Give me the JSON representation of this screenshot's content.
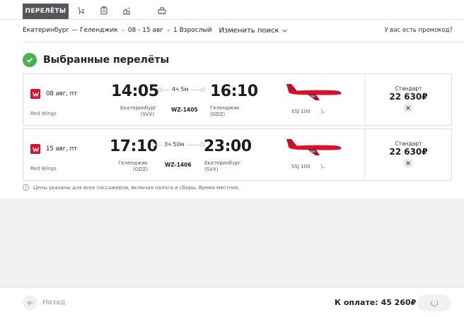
{
  "tabs": {
    "active_label": "ПЕРЕЛЁТЫ",
    "icons": [
      "seat-icon",
      "luggage-icon",
      "hotel-icon",
      "car-icon"
    ]
  },
  "search": {
    "route": "Екатеринбург — Геленджик",
    "dates": "08 - 15 авг",
    "passengers": "1 Взрослый",
    "change_label": "Изменить поиск",
    "promo_label": "У вас есть промокод?"
  },
  "selected": {
    "title": "Выбранные перелёты"
  },
  "flights": [
    {
      "date": "08 авг, пт",
      "airline": "Red Wings",
      "dep_time": "14:05",
      "arr_time": "16:10",
      "duration": "4ч 5м",
      "dep_city": "Екатеринбург",
      "dep_code": "(SVX)",
      "arr_city": "Геленджик",
      "arr_code": "(GDZ)",
      "flight_no": "WZ-1405",
      "aircraft": "SSJ 100",
      "fare": "Стандарт",
      "price": "22 630₽"
    },
    {
      "date": "15 авг, пт",
      "airline": "Red Wings",
      "dep_time": "17:10",
      "arr_time": "23:00",
      "duration": "3ч 50м",
      "dep_city": "Геленджик",
      "dep_code": "(GDZ)",
      "arr_city": "Екатеринбург",
      "arr_code": "(SVX)",
      "flight_no": "WZ-1406",
      "aircraft": "SSJ 100",
      "fare": "Стандарт",
      "price": "22 630₽"
    }
  ],
  "note": "Цены указаны для всех пассажиров, включая налоги и сборы. Время местное.",
  "footer": {
    "back_label": "Назад",
    "pay_label": "К оплате:",
    "pay_total": "45 260₽"
  },
  "colors": {
    "brand_red": "#d6132a",
    "success_green": "#4caf50"
  }
}
